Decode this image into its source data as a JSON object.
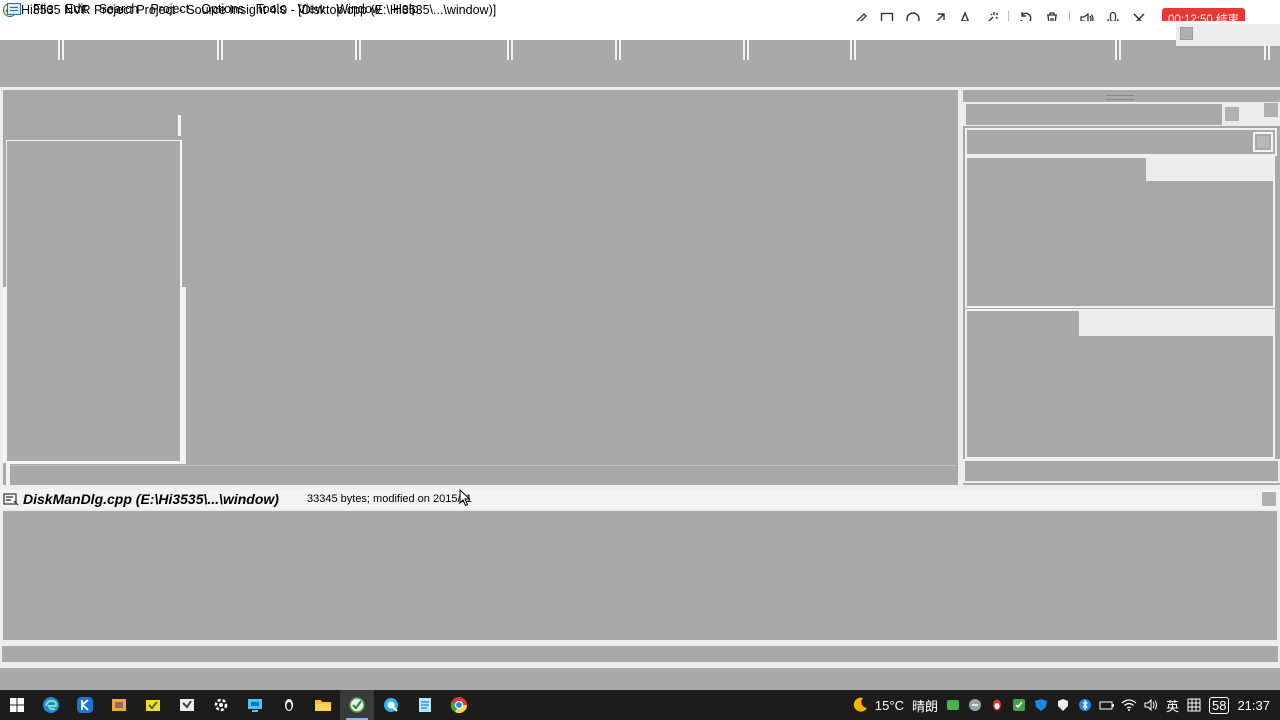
{
  "window": {
    "title": "Hi3535 NVR Project Project - Source Insight 4.0 - [Disktop.cpp (E:\\Hi3535\\...\\window)]"
  },
  "menu": {
    "items": [
      "File",
      "Edit",
      "Search",
      "Project",
      "Options",
      "Tools",
      "View",
      "Window",
      "Help"
    ]
  },
  "recorder": {
    "tools": [
      "pencil-icon",
      "rectangle-icon",
      "circle-icon",
      "arrow-icon",
      "text-icon",
      "magic-wand-icon",
      "undo-icon",
      "trash-icon",
      "speaker-icon",
      "microphone-icon",
      "close-icon"
    ],
    "timer": "00:12:50 结束",
    "timer_color": "#e53935"
  },
  "context": {
    "filename": "DiskManDlg.cpp (E:\\Hi3535\\...\\window)",
    "info": "33345 bytes; modified on 2015/11"
  },
  "taskbar": {
    "apps": [
      "start-icon",
      "edge-icon",
      "kugou-icon",
      "app-icon",
      "folder-tool-icon",
      "store-icon",
      "settings-icon",
      "remote-icon",
      "penguin-icon",
      "file-explorer-icon",
      "source-insight-icon",
      "browser-q-icon",
      "notepad-icon",
      "chrome-icon"
    ],
    "weather": "15°C",
    "weather_text": "晴朗",
    "ime": "英",
    "badge": "58",
    "time": "21:37"
  }
}
